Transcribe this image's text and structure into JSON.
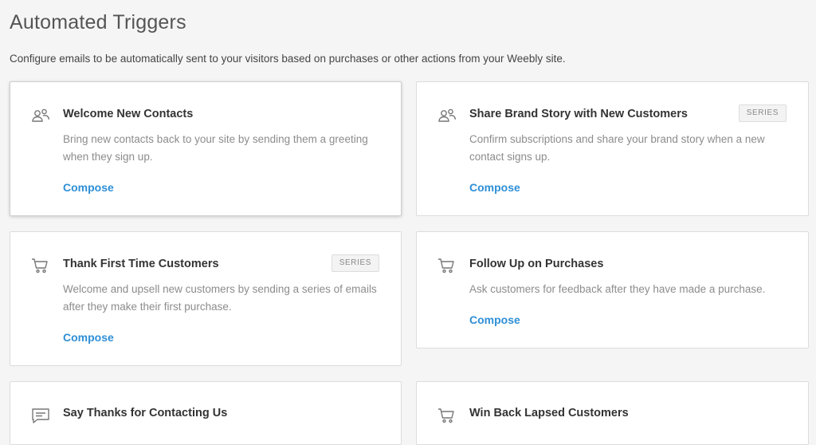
{
  "header": {
    "title": "Automated Triggers",
    "description": "Configure emails to be automatically sent to your visitors based on purchases or other actions from your Weebly site."
  },
  "colors": {
    "accent": "#2e8fd6",
    "background": "#f5f5f5",
    "card": "#ffffff"
  },
  "cards": [
    {
      "icon": "contacts-icon",
      "title": "Welcome New Contacts",
      "badge": "",
      "description": "Bring new contacts back to your site by sending them a greeting when they sign up.",
      "action": "Compose"
    },
    {
      "icon": "contacts-icon",
      "title": "Share Brand Story with New Customers",
      "badge": "SERIES",
      "description": "Confirm subscriptions and share your brand story when a new contact signs up.",
      "action": "Compose"
    },
    {
      "icon": "cart-icon",
      "title": "Thank First Time Customers",
      "badge": "SERIES",
      "description": "Welcome and upsell new customers by sending a series of emails after they make their first purchase.",
      "action": "Compose"
    },
    {
      "icon": "cart-icon",
      "title": "Follow Up on Purchases",
      "badge": "",
      "description": "Ask customers for feedback after they have made a purchase.",
      "action": "Compose"
    },
    {
      "icon": "message-icon",
      "title": "Say Thanks for Contacting Us",
      "badge": "",
      "description": "",
      "action": ""
    },
    {
      "icon": "cart-icon",
      "title": "Win Back Lapsed Customers",
      "badge": "",
      "description": "",
      "action": ""
    }
  ]
}
